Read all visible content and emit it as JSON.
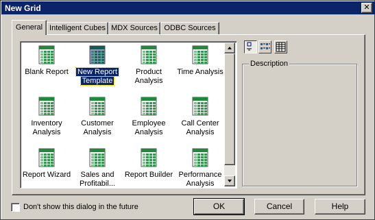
{
  "window": {
    "title": "New Grid",
    "close_glyph": "✕"
  },
  "tabs": [
    {
      "label": "General",
      "active": true
    },
    {
      "label": "Intelligent Cubes",
      "active": false
    },
    {
      "label": "MDX Sources",
      "active": false
    },
    {
      "label": "ODBC Sources",
      "active": false
    }
  ],
  "templates": [
    {
      "line1": "Blank Report",
      "line2": "",
      "icon": "grid-icon",
      "selected": false
    },
    {
      "line1": "New Report",
      "line2": "Template",
      "icon": "grid-icon-dither",
      "selected": true
    },
    {
      "line1": "Product",
      "line2": "Analysis",
      "icon": "grid-icon",
      "selected": false
    },
    {
      "line1": "Time Analysis",
      "line2": "",
      "icon": "grid-icon",
      "selected": false
    },
    {
      "line1": "Inventory",
      "line2": "Analysis",
      "icon": "grid-icon",
      "selected": false
    },
    {
      "line1": "Customer",
      "line2": "Analysis",
      "icon": "grid-icon",
      "selected": false
    },
    {
      "line1": "Employee",
      "line2": "Analysis",
      "icon": "grid-icon",
      "selected": false
    },
    {
      "line1": "Call Center",
      "line2": "Analysis",
      "icon": "grid-icon",
      "selected": false
    },
    {
      "line1": "Report Wizard",
      "line2": "",
      "icon": "grid-icon",
      "selected": false
    },
    {
      "line1": "Sales and",
      "line2": "Profitabil...",
      "icon": "grid-icon",
      "selected": false
    },
    {
      "line1": "Report Builder",
      "line2": "",
      "icon": "grid-icon",
      "selected": false
    },
    {
      "line1": "Performance",
      "line2": "Analysis",
      "icon": "grid-icon",
      "selected": false
    }
  ],
  "view_buttons": [
    {
      "name": "large-icons-view-icon",
      "pressed": true
    },
    {
      "name": "small-icons-view-icon",
      "pressed": false
    },
    {
      "name": "details-view-icon",
      "pressed": false
    }
  ],
  "description": {
    "label": "Description",
    "text": ""
  },
  "footer": {
    "checkbox_label": "Don't show this dialog in the future",
    "checkbox_checked": false,
    "ok_label": "OK",
    "cancel_label": "Cancel",
    "help_label": "Help"
  },
  "colors": {
    "title_bar": "#0a246a",
    "face": "#d4d0c8",
    "icon_green": "#1e8a3a"
  }
}
